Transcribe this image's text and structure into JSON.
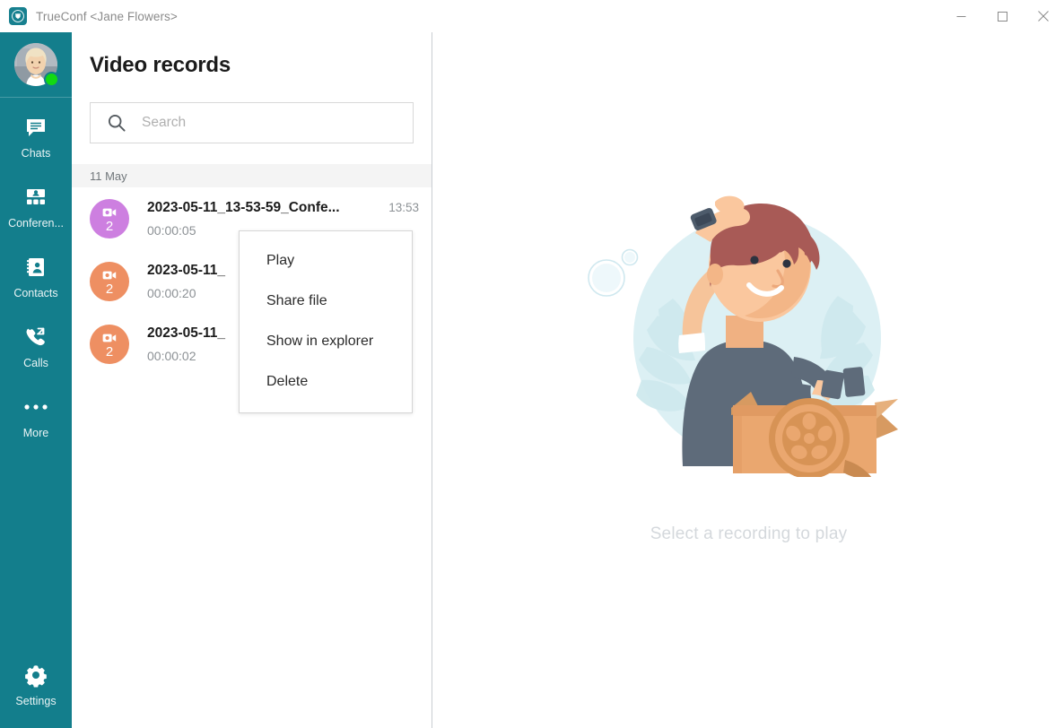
{
  "window": {
    "title": "TrueConf <Jane Flowers>",
    "logo_icon": "trueconf-paw-logo-icon",
    "controls": {
      "minimize": "minimize-icon",
      "maximize": "maximize-icon",
      "close": "close-icon"
    }
  },
  "colors": {
    "rail_background": "#137e8c",
    "status_online": "#12d912",
    "avatar_purple": "#cd7fe0",
    "avatar_orange": "#ee8f62",
    "panel_divider": "#c9cdd2",
    "date_header_bg": "#f4f4f4",
    "caption_gray": "#d4d8dc"
  },
  "sidebar": {
    "profile": {
      "avatar": "user-avatar",
      "status": "online"
    },
    "items": [
      {
        "label": "Chats",
        "icon": "chat-bubble-icon"
      },
      {
        "label": "Conferen...",
        "icon": "conference-icon"
      },
      {
        "label": "Contacts",
        "icon": "contacts-book-icon"
      },
      {
        "label": "Calls",
        "icon": "phone-calls-icon"
      },
      {
        "label": "More",
        "icon": "ellipsis-icon"
      }
    ],
    "bottom": {
      "label": "Settings",
      "icon": "gear-icon"
    }
  },
  "list_panel": {
    "title": "Video records",
    "search": {
      "placeholder": "Search",
      "value": "",
      "icon": "search-icon"
    },
    "date_header": "11 May",
    "records": [
      {
        "name": "2023-05-11_13-53-59_Confe...",
        "time": "13:53",
        "duration": "00:00:05",
        "participants": "2",
        "avatar_color": "#cd7fe0",
        "icon": "video-camera-icon"
      },
      {
        "name": "2023-05-11_",
        "time": "",
        "duration": "00:00:20",
        "participants": "2",
        "avatar_color": "#ee8f62",
        "icon": "video-camera-icon"
      },
      {
        "name": "2023-05-11_",
        "time": "",
        "duration": "00:00:02",
        "participants": "2",
        "avatar_color": "#ee8f62",
        "icon": "video-camera-icon"
      }
    ]
  },
  "context_menu": {
    "items": [
      {
        "label": "Play"
      },
      {
        "label": "Share file"
      },
      {
        "label": "Show in explorer"
      },
      {
        "label": "Delete"
      }
    ]
  },
  "stage": {
    "illustration": "man-looking-into-box-with-film-reel-illustration",
    "caption": "Select a recording to play"
  }
}
